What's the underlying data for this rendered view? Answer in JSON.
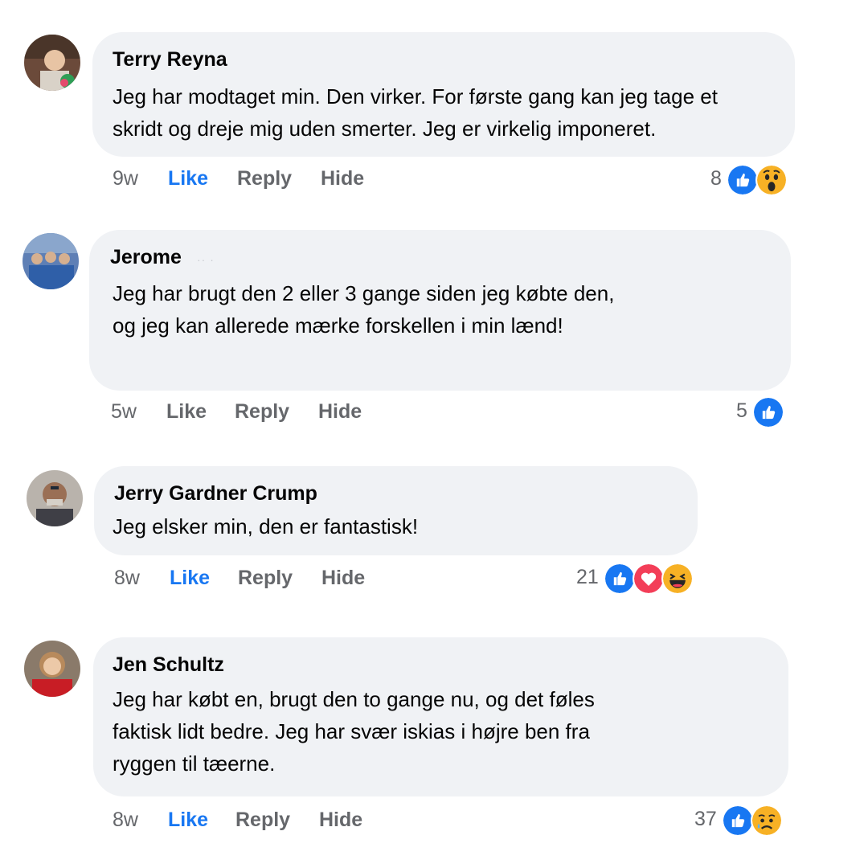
{
  "comments": [
    {
      "author": "Terry Reyna",
      "text": "Jeg har modtaget min. Den virker. For første gang kan jeg tage et\nskridt og dreje mig uden smerter. Jeg er virkelig imponeret.",
      "time": "9w",
      "like_label": "Like",
      "reply_label": "Reply",
      "hide_label": "Hide",
      "like_active": true,
      "reaction_count": "8",
      "reactions": [
        "like-icon",
        "wow-icon"
      ]
    },
    {
      "author": "Jerome",
      "author_suffix": "·· ·",
      "text": "Jeg har brugt den 2 eller 3 gange siden jeg købte den,\nog jeg kan allerede mærke forskellen i min lænd!",
      "time": "5w",
      "like_label": "Like",
      "reply_label": "Reply",
      "hide_label": "Hide",
      "like_active": false,
      "reaction_count": "5",
      "reactions": [
        "like-icon"
      ]
    },
    {
      "author": "Jerry Gardner Crump",
      "text": "Jeg elsker min, den er fantastisk!",
      "time": "8w",
      "like_label": "Like",
      "reply_label": "Reply",
      "hide_label": "Hide",
      "like_active": true,
      "reaction_count": "21",
      "reactions": [
        "like-icon",
        "love-icon",
        "haha-icon"
      ]
    },
    {
      "author": "Jen Schultz",
      "text": "Jeg har købt en, brugt den to gange nu, og det føles\n faktisk lidt bedre. Jeg har svær iskias i højre ben fra\n ryggen til tæerne.",
      "time": "8w",
      "like_label": "Like",
      "reply_label": "Reply",
      "hide_label": "Hide",
      "like_active": true,
      "reaction_count": "37",
      "reactions": [
        "like-icon",
        "sad-icon"
      ]
    }
  ],
  "colors": {
    "bubble": "#f0f2f5",
    "like_blue": "#1877f2",
    "muted": "#65676b",
    "love_red": "#f33e58",
    "emoji_yellow": "#f7b125"
  }
}
